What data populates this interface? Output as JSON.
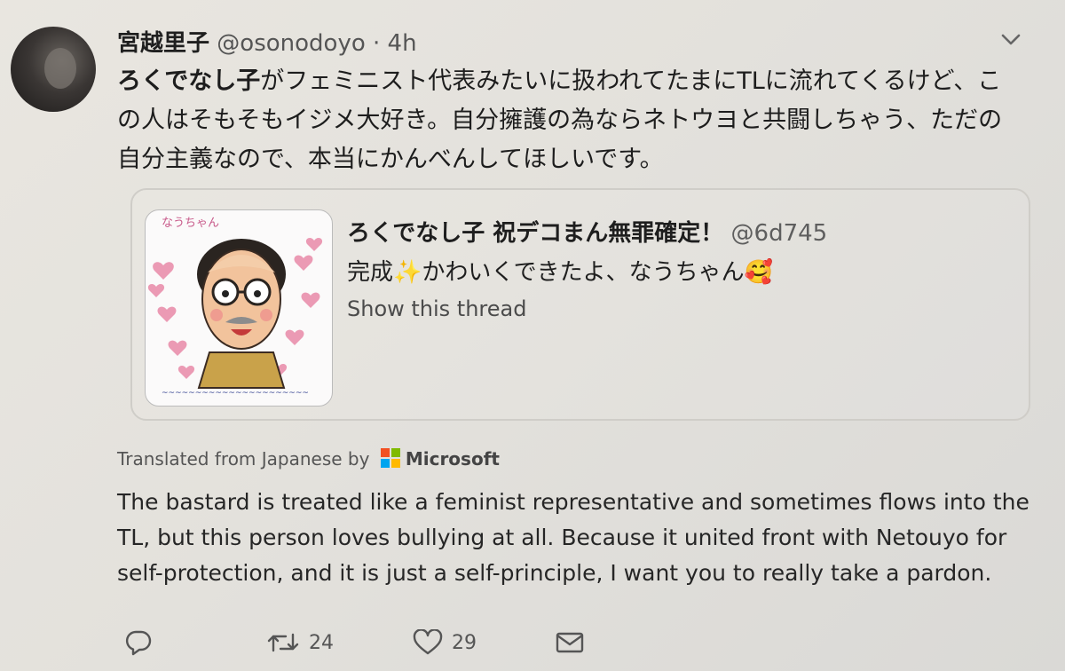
{
  "tweet": {
    "name": "宮越里子",
    "handle": "@osonodoyo",
    "separator": "·",
    "time": "4h",
    "text_strong": "ろくでなし子",
    "text_rest": "がフェミニスト代表みたいに扱われてたまにTLに流れてくるけど、この人はそもそもイジメ大好き。自分擁護の為ならネトウヨと共闘しちゃう、ただの自分主義なので、本当にかんべんしてほしいです。",
    "avatar_icon": "user-avatar"
  },
  "quoted": {
    "name": "ろくでなし子 祝デコまん無罪確定！",
    "handle": "@6d745",
    "text_before": "完成",
    "sparkle": "✨",
    "text_after": "かわいくできたよ、なうちゃん",
    "emoji": "🥰",
    "show_thread": "Show this thread",
    "image_caption": "なうちゃん"
  },
  "translation": {
    "label": "Translated from Japanese by",
    "provider": "Microsoft",
    "text": "The bastard is treated like a feminist representative and sometimes flows into the TL, but this person loves bullying at all. Because it united front with Netouyo for self-protection, and it is just a self-principle, I want you to really take a pardon."
  },
  "actions": {
    "reply_icon": "reply-icon",
    "retweet_icon": "retweet-icon",
    "retweet_count": "24",
    "like_icon": "heart-icon",
    "like_count": "29",
    "dm_icon": "envelope-icon"
  },
  "colors": {
    "background": "#e6e4df",
    "text": "#1d1d1d",
    "secondary": "#555555",
    "card_border": "#cfcdc8"
  }
}
